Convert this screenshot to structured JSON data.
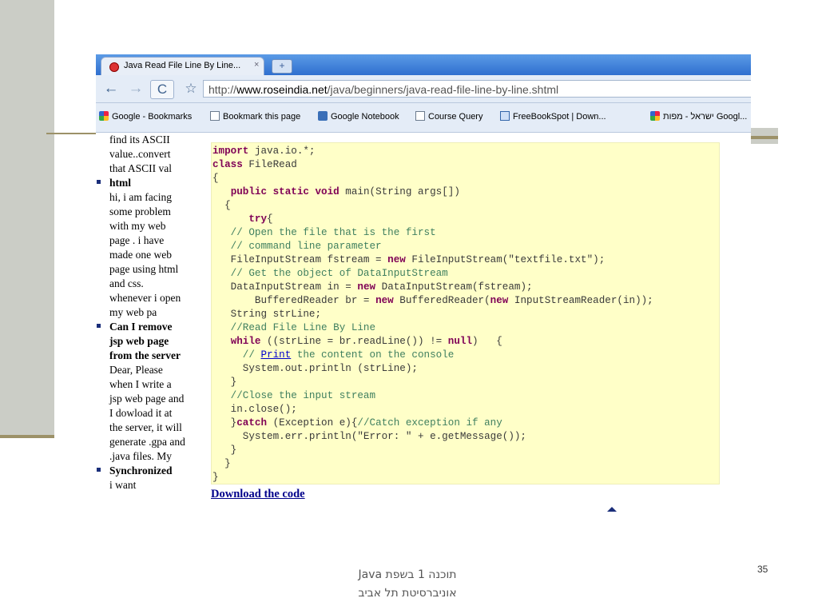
{
  "browser": {
    "tab": {
      "title": "Java Read File Line By Line...",
      "close": "×"
    },
    "new_tab": "+",
    "nav": {
      "back": "←",
      "forward": "→",
      "reload": "C",
      "star": "☆"
    },
    "address": {
      "prefix": "http://",
      "domain": "www.roseindia.net",
      "path": "/java/beginners/java-read-file-line-by-line.shtml"
    },
    "bookmarks": [
      {
        "label": "Google - Bookmarks",
        "icon": "google-icon"
      },
      {
        "label": "Bookmark this page",
        "icon": "page-icon"
      },
      {
        "label": "Google Notebook",
        "icon": "notebook-icon"
      },
      {
        "label": "Course Query",
        "icon": "page-icon"
      },
      {
        "label": "FreeBookSpot | Down...",
        "icon": "book-icon"
      },
      {
        "label": "ישראל - מפות Googl...",
        "icon": "google-icon"
      }
    ]
  },
  "sidebar": {
    "cont_lines": [
      "find its ASCII",
      "value..convert",
      "that ASCII val"
    ],
    "items": [
      {
        "title": [
          "html"
        ],
        "body": [
          "hi, i am facing",
          "some problem",
          "with my web",
          "page . i have",
          "made one web",
          "page using html",
          "and css.",
          "whenever i open",
          "my web pa"
        ]
      },
      {
        "title": [
          "Can I remove",
          "jsp web page",
          "from the server"
        ],
        "body": [
          "Dear, Please",
          "when I write a",
          "jsp web page and",
          "I dowload it at",
          "the server, it will",
          "generate .gpa and",
          ".java files. My"
        ]
      },
      {
        "title": [
          "Synchronized"
        ],
        "body": [
          "i want"
        ]
      }
    ]
  },
  "code": {
    "line01": [
      "import",
      " java.io.*;"
    ],
    "line02": [
      "class",
      " FileRead"
    ],
    "line03": "{",
    "line04": [
      "   ",
      "public static void",
      " main(String args[])"
    ],
    "line05": "  {",
    "line06": [
      "      ",
      "try",
      "{"
    ],
    "line07": "   // Open the file that is the first",
    "line08": "   // command line parameter",
    "line09": [
      "   FileInputStream fstream = ",
      "new",
      " FileInputStream(\"textfile.txt\");"
    ],
    "line10": "   // Get the object of DataInputStream",
    "line11": [
      "   DataInputStream in = ",
      "new",
      " DataInputStream(fstream);"
    ],
    "line12": [
      "       BufferedReader br = ",
      "new",
      " BufferedReader(",
      "new",
      " InputStreamReader(in));"
    ],
    "line13": "   String strLine;",
    "line14": "   //Read File Line By Line",
    "line15": [
      "   ",
      "while",
      " ((strLine = br.readLine()) != ",
      "null",
      ")   {"
    ],
    "line16": [
      "     // ",
      "Print",
      " the content on the console"
    ],
    "line17": "     System.out.println (strLine);",
    "line18": "   }",
    "line19": "   //Close the input stream",
    "line20": "   in.close();",
    "line21": [
      "   }",
      "catch",
      " (Exception e){",
      "//Catch exception if any"
    ],
    "line22": "     System.err.println(\"Error: \" + e.getMessage());",
    "line23": "   }",
    "line24": "  }",
    "line25": "}"
  },
  "download_link": "Download the code",
  "footer": {
    "line1": "תוכנה 1 בשפת Java",
    "line2": "אוניברסיטת תל אביב"
  },
  "page_number": "35"
}
